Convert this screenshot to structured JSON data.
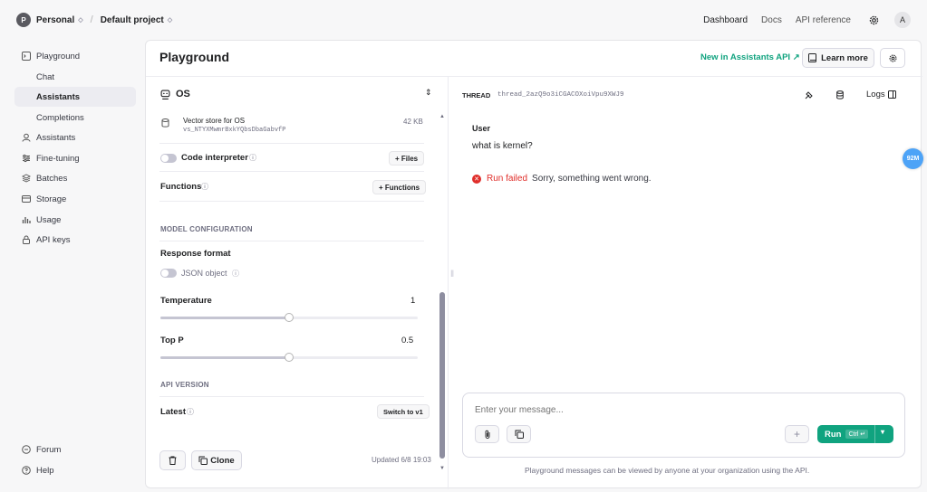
{
  "topbar": {
    "org_initial": "P",
    "org_name": "Personal",
    "project_name": "Default project",
    "nav": [
      "Dashboard",
      "Docs",
      "API reference"
    ],
    "user_initial": "A"
  },
  "sidebar": {
    "items": [
      {
        "label": "Playground",
        "icon": "terminal-icon"
      },
      {
        "label": "Chat",
        "icon": ""
      },
      {
        "label": "Assistants",
        "icon": ""
      },
      {
        "label": "Completions",
        "icon": ""
      },
      {
        "label": "Assistants",
        "icon": "assistant-icon"
      },
      {
        "label": "Fine-tuning",
        "icon": "fine-tune-icon"
      },
      {
        "label": "Batches",
        "icon": "batches-icon"
      },
      {
        "label": "Storage",
        "icon": "storage-icon"
      },
      {
        "label": "Usage",
        "icon": "usage-icon"
      },
      {
        "label": "API keys",
        "icon": "lock-icon"
      }
    ],
    "footer": [
      {
        "label": "Forum",
        "icon": "forum-icon"
      },
      {
        "label": "Help",
        "icon": "help-icon"
      }
    ]
  },
  "header": {
    "title": "Playground",
    "new_link": "New in Assistants API ↗",
    "learn_more": "Learn more"
  },
  "assistant": {
    "name": "OS",
    "vector_store_name": "Vector store for OS",
    "vector_store_id": "vs_NTYXMwmrBxkYQbsDbaGabvfP",
    "vector_store_size": "42 KB",
    "code_interpreter": "Code interpreter",
    "files_button": "+ Files",
    "functions": "Functions",
    "functions_button": "+ Functions",
    "model_config_title": "MODEL CONFIGURATION",
    "response_format": "Response format",
    "json_object": "JSON object",
    "temperature_label": "Temperature",
    "temperature_value": "1",
    "temperature_level": 0.5,
    "top_p_label": "Top P",
    "top_p_value": "0.5",
    "top_p_level": 0.5,
    "api_version_title": "API VERSION",
    "api_version_label": "Latest",
    "switch_button": "Switch to v1",
    "clone_button": "Clone",
    "updated": "Updated 6/8 19:03"
  },
  "thread": {
    "label": "THREAD",
    "id": "thread_2azQ9o3iCGACOXoiVpu9XWJ9",
    "logs": "Logs",
    "user_role": "User",
    "user_message": "what is kernel?",
    "run_status": "Run failed",
    "error_message": "Sorry, something went wrong."
  },
  "composer": {
    "placeholder": "Enter your message...",
    "run_label": "Run",
    "shortcut": "Ctrl ↵",
    "footer_note": "Playground messages can be viewed by anyone at your organization using the API."
  },
  "overlay": {
    "badge": "92M"
  },
  "colors": {
    "accent": "#10a37f",
    "error": "#e02e2a",
    "badge": "#4da3f7"
  }
}
